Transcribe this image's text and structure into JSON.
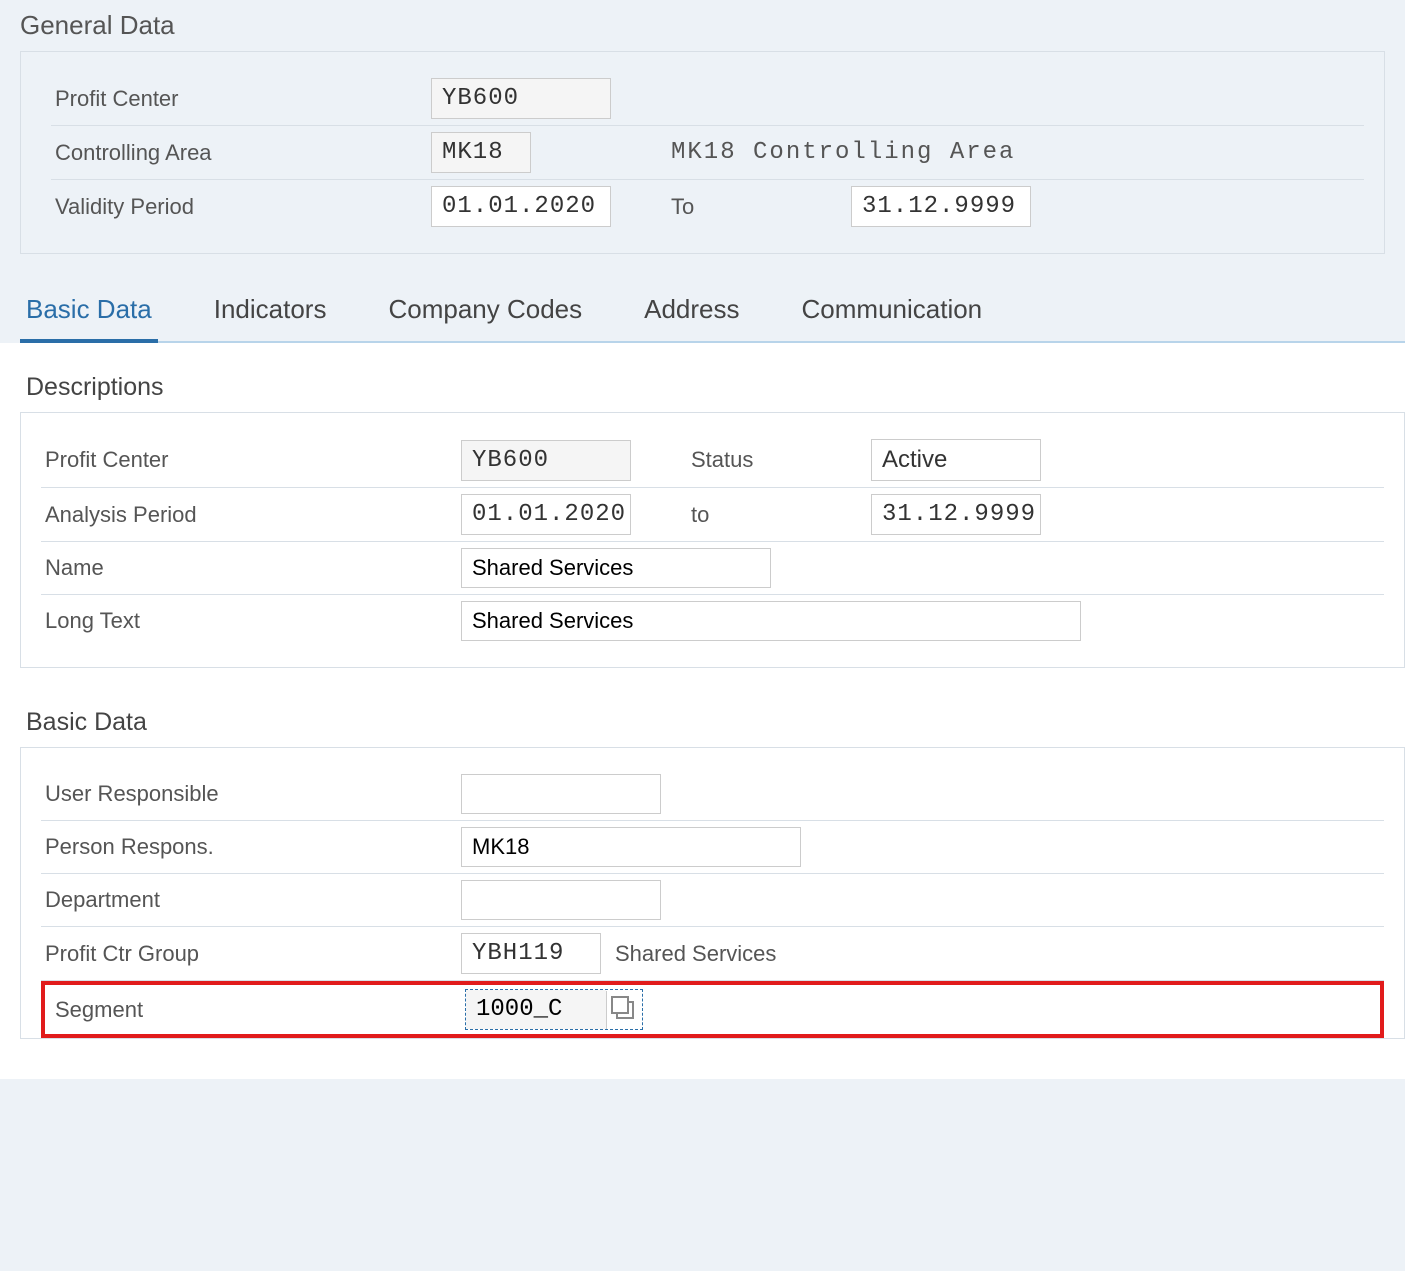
{
  "general": {
    "title": "General Data",
    "profit_center_label": "Profit Center",
    "profit_center_value": "YB600",
    "controlling_area_label": "Controlling Area",
    "controlling_area_value": "MK18",
    "controlling_area_desc": "MK18 Controlling Area",
    "validity_period_label": "Validity Period",
    "validity_from": "01.01.2020",
    "validity_to_label": "To",
    "validity_to": "31.12.9999"
  },
  "tabs": {
    "basic_data": "Basic Data",
    "indicators": "Indicators",
    "company_codes": "Company Codes",
    "address": "Address",
    "communication": "Communication"
  },
  "descriptions": {
    "title": "Descriptions",
    "profit_center_label": "Profit Center",
    "profit_center_value": "YB600",
    "status_label": "Status",
    "status_value": "Active",
    "analysis_period_label": "Analysis Period",
    "analysis_from": "01.01.2020",
    "analysis_to_label": "to",
    "analysis_to": "31.12.9999",
    "name_label": "Name",
    "name_value": "Shared Services",
    "long_text_label": "Long Text",
    "long_text_value": "Shared Services"
  },
  "basic": {
    "title": "Basic Data",
    "user_responsible_label": "User Responsible",
    "user_responsible_value": "",
    "person_respons_label": "Person Respons.",
    "person_respons_value": "MK18",
    "department_label": "Department",
    "department_value": "",
    "profit_ctr_group_label": "Profit Ctr Group",
    "profit_ctr_group_value": "YBH119",
    "profit_ctr_group_desc": "Shared Services",
    "segment_label": "Segment",
    "segment_value": "1000_C"
  }
}
